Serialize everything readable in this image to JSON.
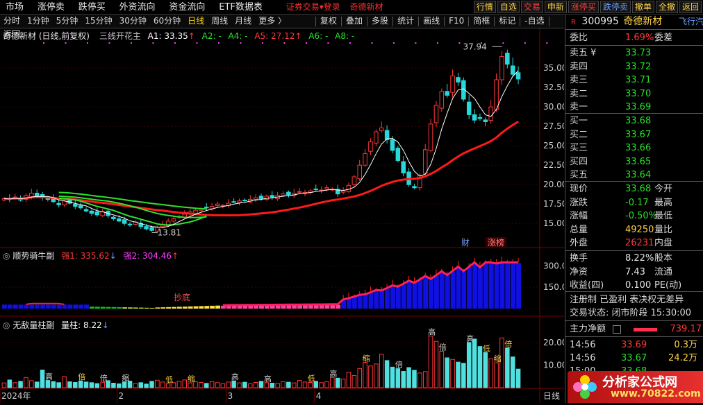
{
  "menu": {
    "items": [
      "市场",
      "涨停卖",
      "跌停买",
      "外资流向",
      "资金流向",
      "ETF数据表"
    ],
    "login_label": "证券交易▾登录",
    "stock_title": "奇德新材",
    "right_buttons": [
      {
        "label": "行情",
        "color": "#ffd24a"
      },
      {
        "label": "自选",
        "color": "#ffd24a"
      },
      {
        "label": "交易",
        "color": "#ff4040"
      },
      {
        "label": "申新",
        "color": "#ffd24a"
      },
      {
        "label": "涨停买",
        "color": "#ff4040"
      },
      {
        "label": "跌停卖",
        "color": "#6fa0ff"
      },
      {
        "label": "撤单",
        "color": "#ffd24a"
      },
      {
        "label": "全撤",
        "color": "#ffd24a"
      },
      {
        "label": "返回",
        "color": "#ffd24a"
      }
    ]
  },
  "toolbar": {
    "periods": [
      "分时",
      "1分钟",
      "5分钟",
      "15分钟",
      "30分钟",
      "60分钟",
      "日线",
      "周线",
      "月线",
      "更多 〉"
    ],
    "active": "日线",
    "tools": [
      "复权",
      "叠加",
      "多股",
      "统计",
      "画线",
      "F10",
      "简框",
      "标记",
      "-自选",
      "返回"
    ]
  },
  "main_chart": {
    "stock": "奇德新材 (日线,前复权)",
    "indicator": "三线开花主",
    "a1": "A1: 33.35",
    "a2": "A2: -",
    "a4": "A4: -",
    "a5": "A5: 27.12",
    "a6": "A6: -",
    "a8": "A8: -",
    "high_label": "37.94",
    "low_label": "13.81",
    "yticks": [
      "35.00",
      "32.50",
      "30.00",
      "27.50",
      "25.00",
      "22.50",
      "20.00",
      "17.50",
      "15.00"
    ],
    "badge_cai": "财",
    "badge_zhangbang": "涨榜",
    "up_arrow": "↑",
    "down_arrow": "↓"
  },
  "sub_chart1": {
    "name": "顺势骑牛副",
    "qiang1": "强1: 335.62",
    "qiang2": "强2: 304.46",
    "yticks": [
      "300.0",
      "150.0"
    ],
    "annotation": "抄底"
  },
  "sub_chart2": {
    "name": "无敌量柱副",
    "liangzhu": "量柱: 8.22",
    "yticks": [
      "20.00",
      "10.00"
    ],
    "bar_marks": [
      "高",
      "倍",
      "缩",
      "低",
      "高",
      "高",
      "低",
      "高",
      "缩",
      "倍",
      "高",
      "倍",
      "高",
      "低",
      "缩",
      "倍",
      "缩",
      "倍"
    ]
  },
  "xaxis": {
    "labels": [
      "2024年",
      "2",
      "3",
      "4"
    ],
    "period_tag": "日线"
  },
  "panel": {
    "flag": "R",
    "code": "300995",
    "name": "奇德新材",
    "corner": "飞行汽",
    "weibi_label": "委比",
    "weibi_value": "1.69%",
    "weicha_label": "委差",
    "asks": [
      {
        "label": "卖五 ¥",
        "price": "33.73"
      },
      {
        "label": "卖四",
        "price": "33.72"
      },
      {
        "label": "卖三",
        "price": "33.71"
      },
      {
        "label": "卖二",
        "price": "33.70"
      },
      {
        "label": "卖一",
        "price": "33.69"
      }
    ],
    "bids": [
      {
        "label": "买一",
        "price": "33.68"
      },
      {
        "label": "买二",
        "price": "33.67"
      },
      {
        "label": "买三",
        "price": "33.66"
      },
      {
        "label": "买四",
        "price": "33.65"
      },
      {
        "label": "买五",
        "price": "33.64"
      }
    ],
    "quote": [
      {
        "k": "现价",
        "v": "33.68",
        "k2": "今开",
        "cls": "g"
      },
      {
        "k": "涨跌",
        "v": "-0.17",
        "k2": "最高",
        "cls": "g"
      },
      {
        "k": "涨幅",
        "v": "-0.50%",
        "k2": "最低",
        "cls": "g"
      },
      {
        "k": "总量",
        "v": "49250",
        "k2": "量比",
        "cls": "y"
      },
      {
        "k": "外盘",
        "v": "26231",
        "k2": "内盘",
        "cls": "r"
      }
    ],
    "stats": [
      {
        "k": "换手",
        "v": "8.22%",
        "k2": "股本"
      },
      {
        "k": "净资",
        "v": "7.43",
        "k2": "流通"
      },
      {
        "k": "收益(四)",
        "v": "0.100",
        "k2": "PE(动)"
      }
    ],
    "reg_line": "注册制 已盈利 表决权无差异",
    "status_line": "交易状态: 闭市阶段 15:30:00",
    "main_net_label": "主力净额",
    "main_net_value": "739.17",
    "ticks": [
      {
        "t": "14:56",
        "p": "33.69",
        "v": "0.3万",
        "pc": "r",
        "vc": "y"
      },
      {
        "t": "14:56",
        "p": "33.67",
        "v": "24.2万",
        "pc": "g",
        "vc": "y"
      },
      {
        "t": "15:00",
        "p": "33.68",
        "v": "",
        "pc": "g",
        "vc": "y"
      }
    ],
    "watermark_text": "分析家公式网",
    "watermark_url": "www.70822.com"
  },
  "chart_data": [
    {
      "type": "candlestick",
      "title": "三线开花主",
      "series": [
        {
          "name": "A1",
          "last": 33.35
        },
        {
          "name": "A5",
          "last": 27.12
        }
      ],
      "ylim": [
        13.5,
        38.5
      ],
      "x_labels": [
        "2024年",
        "2",
        "3",
        "4"
      ],
      "annotations": [
        {
          "text": "37.94",
          "kind": "high"
        },
        {
          "text": "13.81",
          "kind": "low"
        }
      ],
      "closes": [
        18.2,
        18.1,
        18.4,
        18.0,
        18.6,
        18.9,
        18.5,
        18.3,
        18.1,
        17.8,
        17.4,
        17.9,
        17.6,
        17.2,
        17.0,
        16.6,
        16.3,
        16.1,
        16.5,
        16.0,
        15.6,
        15.3,
        15.0,
        14.8,
        15.2,
        14.6,
        14.3,
        14.1,
        14.5,
        14.9,
        15.3,
        15.6,
        15.9,
        16.2,
        16.5,
        16.7,
        16.9,
        17.0,
        17.2,
        17.5,
        17.3,
        17.6,
        17.8,
        17.9,
        18.0,
        18.1,
        18.3,
        18.2,
        18.5,
        18.4,
        18.6,
        18.8,
        18.7,
        18.9,
        19.1,
        19.0,
        19.2,
        19.4,
        19.3,
        19.6,
        19.4,
        18.8,
        19.2,
        19.9,
        21.0,
        22.5,
        24.0,
        25.5,
        26.8,
        27.3,
        25.8,
        24.4,
        23.1,
        21.5,
        20.0,
        19.6,
        21.2,
        24.5,
        27.8,
        30.2,
        32.0,
        31.5,
        34.0,
        33.2,
        31.0,
        29.0,
        28.3,
        28.5,
        28.1,
        30.0,
        33.5,
        36.5,
        35.5,
        34.2,
        33.6
      ]
    },
    {
      "type": "bar",
      "title": "顺势骑牛副",
      "series": [
        {
          "name": "强1",
          "last": 335.62
        },
        {
          "name": "强2",
          "last": 304.46
        }
      ],
      "ylim": [
        0,
        360
      ]
    },
    {
      "type": "bar",
      "title": "无敌量柱副",
      "series": [
        {
          "name": "量柱",
          "last": 8.22
        }
      ],
      "ylim": [
        0,
        27
      ],
      "values": [
        2.1,
        3.4,
        2.2,
        2.8,
        4.5,
        3.1,
        2.5,
        7.8,
        3.2,
        2.7,
        2.2,
        4.9,
        2.6,
        2.3,
        3.0,
        2.5,
        2.2,
        1.8,
        2.4,
        3.1,
        2.0,
        1.7,
        2.6,
        2.9,
        1.9,
        2.2,
        1.6,
        2.8,
        3.3,
        2.5,
        1.8,
        2.2,
        2.9,
        3.4,
        2.1,
        2.6,
        2.3,
        1.9,
        2.7,
        2.2,
        1.8,
        2.5,
        3.0,
        2.1,
        2.4,
        1.7,
        2.3,
        2.8,
        2.2,
        2.0,
        1.9,
        2.6,
        2.4,
        2.1,
        3.2,
        2.5,
        2.3,
        2.8,
        2.2,
        2.6,
        4.5,
        4.2,
        3.8,
        6.8,
        5.4,
        8.5,
        11.2,
        9.6,
        10.5,
        14.8,
        12.0,
        9.1,
        8.4,
        7.2,
        8.9,
        7.7,
        6.5,
        7.1,
        22.8,
        20.5,
        16.1,
        13.2,
        12.5,
        11.3,
        10.8,
        20.0,
        21.5,
        18.2,
        15.5,
        12.8,
        11.0,
        22.0,
        17.5,
        13.6,
        8.22
      ]
    }
  ]
}
